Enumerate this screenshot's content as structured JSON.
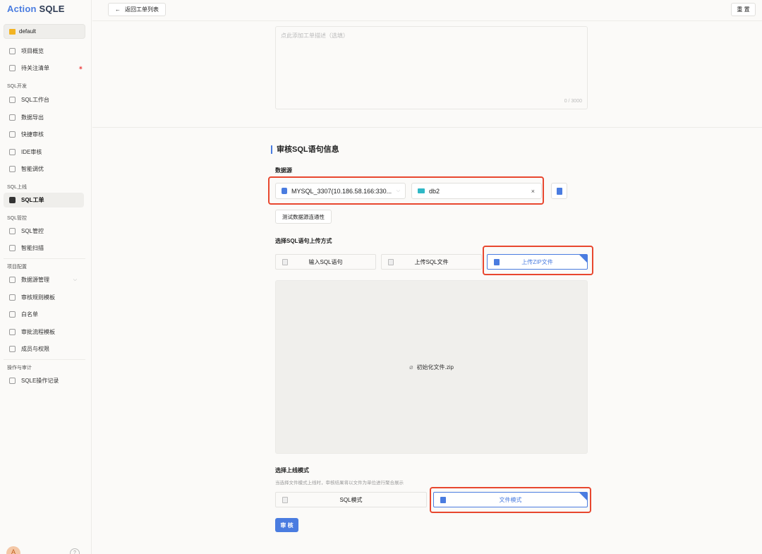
{
  "app": {
    "logo_a": "Action",
    "logo_b": "SQLE"
  },
  "sidebar": {
    "project": "default",
    "top_items": [
      {
        "label": "项目概览"
      },
      {
        "label": "待关注清单"
      }
    ],
    "groups": {
      "sql_dev": "SQL开发",
      "sql_release": "SQL上线",
      "sql_control": "SQL管控",
      "project_config": "项目配置",
      "ops_audit": "操作与审计"
    },
    "sql_dev_items": [
      "SQL工作台",
      "数据导出",
      "快捷审核",
      "IDE审核",
      "智能调优"
    ],
    "sql_release_items": [
      "SQL工单"
    ],
    "sql_control_items": [
      "SQL管控",
      "智能扫描"
    ],
    "config_items": [
      "数据源管理",
      "审核规则模板",
      "白名单",
      "审批流程模板",
      "成员与权限"
    ],
    "audit_items": [
      "SQLE操作记录"
    ],
    "avatar": "A",
    "help": "?"
  },
  "header": {
    "back_label": "返回工单列表",
    "back_arrow": "←",
    "reset_label": "重 置"
  },
  "description": {
    "placeholder": "点此添加工单描述（选填）",
    "counter": "0 / 3000"
  },
  "section": {
    "title": "审核SQL语句信息",
    "datasource_label": "数据源",
    "datasource_value": "MYSQL_3307(10.186.58.166:330...",
    "schema_value": "db2",
    "clear": "×",
    "dropdown_arrow": "⌵",
    "test_label": "测试数据源连通性",
    "upload_label": "选择SQL语句上传方式",
    "upload_options": [
      "输入SQL语句",
      "上传SQL文件",
      "上传ZIP文件"
    ],
    "file_name": "初始化文件.zip",
    "clip": "⌀",
    "mode_label": "选择上线模式",
    "mode_hint": "当选择文件模式上线时，审核结果将以文件为单位进行聚合展示",
    "mode_options": [
      "SQL模式",
      "文件模式"
    ],
    "submit_label": "审 核"
  },
  "colors": {
    "accent": "#4a7ce0",
    "highlight": "#e8472f"
  }
}
